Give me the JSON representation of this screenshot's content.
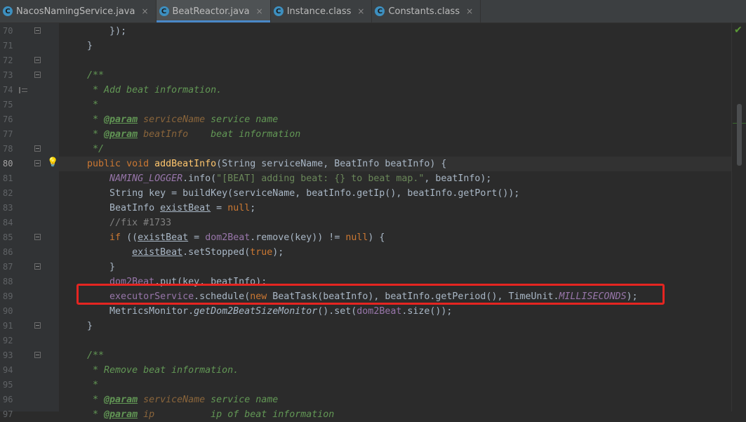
{
  "tabs": [
    {
      "label": "NacosNamingService.java",
      "icon": "C",
      "active": false
    },
    {
      "label": "BeatReactor.java",
      "icon": "C",
      "active": true
    },
    {
      "label": "Instance.class",
      "icon": "C",
      "active": false
    },
    {
      "label": "Constants.class",
      "icon": "C",
      "active": false
    }
  ],
  "tab_close_glyph": "×",
  "current_line": 80,
  "lines": [
    {
      "n": "70",
      "segs": [
        {
          "t": "        "
        },
        {
          "t": "}"
        },
        {
          "t": ");"
        }
      ]
    },
    {
      "n": "71",
      "segs": [
        {
          "t": "    }"
        }
      ]
    },
    {
      "n": "72",
      "segs": []
    },
    {
      "n": "73",
      "segs": [
        {
          "t": "    "
        },
        {
          "t": "/**",
          "c": "doc"
        }
      ]
    },
    {
      "n": "74",
      "segs": [
        {
          "t": "     * Add beat information.",
          "c": "doc"
        }
      ]
    },
    {
      "n": "75",
      "segs": [
        {
          "t": "     *",
          "c": "doc"
        }
      ]
    },
    {
      "n": "76",
      "segs": [
        {
          "t": "     * ",
          "c": "doc"
        },
        {
          "t": "@param",
          "c": "doctag"
        },
        {
          "t": " ",
          "c": "doc"
        },
        {
          "t": "serviceName",
          "c": "docparam"
        },
        {
          "t": " service name",
          "c": "doc"
        }
      ]
    },
    {
      "n": "77",
      "segs": [
        {
          "t": "     * ",
          "c": "doc"
        },
        {
          "t": "@param",
          "c": "doctag"
        },
        {
          "t": " ",
          "c": "doc"
        },
        {
          "t": "beatInfo",
          "c": "docparam"
        },
        {
          "t": "    beat information",
          "c": "doc"
        }
      ]
    },
    {
      "n": "78",
      "segs": [
        {
          "t": "     */",
          "c": "doc"
        }
      ]
    },
    {
      "n": "80",
      "segs": [
        {
          "t": "    "
        },
        {
          "t": "public void ",
          "c": "kw"
        },
        {
          "t": "addBeatInfo",
          "c": "method"
        },
        {
          "t": "(String serviceName, BeatInfo beatInfo) {"
        }
      ]
    },
    {
      "n": "81",
      "segs": [
        {
          "t": "        "
        },
        {
          "t": "NAMING_LOGGER",
          "c": "static"
        },
        {
          "t": ".info("
        },
        {
          "t": "\"[BEAT] adding beat: {} to beat map.\"",
          "c": "str"
        },
        {
          "t": ", beatInfo);"
        }
      ]
    },
    {
      "n": "82",
      "segs": [
        {
          "t": "        String key = buildKey(serviceName, beatInfo.getIp(), beatInfo.getPort());"
        }
      ]
    },
    {
      "n": "83",
      "segs": [
        {
          "t": "        BeatInfo "
        },
        {
          "t": "existBeat",
          "c": "under"
        },
        {
          "t": " = "
        },
        {
          "t": "null",
          "c": "kw"
        },
        {
          "t": ";"
        }
      ]
    },
    {
      "n": "84",
      "segs": [
        {
          "t": "        "
        },
        {
          "t": "//fix #1733",
          "c": "comment"
        }
      ]
    },
    {
      "n": "85",
      "segs": [
        {
          "t": "        "
        },
        {
          "t": "if",
          "c": "kw"
        },
        {
          "t": " (("
        },
        {
          "t": "existBeat",
          "c": "under"
        },
        {
          "t": " = "
        },
        {
          "t": "dom2Beat",
          "c": "field"
        },
        {
          "t": ".remove(key)) != "
        },
        {
          "t": "null",
          "c": "kw"
        },
        {
          "t": ") {"
        }
      ]
    },
    {
      "n": "86",
      "segs": [
        {
          "t": "            "
        },
        {
          "t": "existBeat",
          "c": "under"
        },
        {
          "t": ".setStopped("
        },
        {
          "t": "true",
          "c": "kw"
        },
        {
          "t": ");"
        }
      ]
    },
    {
      "n": "87",
      "segs": [
        {
          "t": "        }"
        }
      ]
    },
    {
      "n": "88",
      "segs": [
        {
          "t": "        "
        },
        {
          "t": "dom2Beat",
          "c": "field"
        },
        {
          "t": ".put(key, beatInfo);"
        }
      ]
    },
    {
      "n": "89",
      "segs": [
        {
          "t": "        "
        },
        {
          "t": "executorService",
          "c": "field"
        },
        {
          "t": ".schedule("
        },
        {
          "t": "new ",
          "c": "kw"
        },
        {
          "t": "BeatTask(beatInfo), beatInfo.getPeriod(), TimeUnit."
        },
        {
          "t": "MILLISECONDS",
          "c": "static"
        },
        {
          "t": ");"
        }
      ]
    },
    {
      "n": "90",
      "segs": [
        {
          "t": "        MetricsMonitor."
        },
        {
          "t": "getDom2BeatSizeMonitor",
          "c": "staticm"
        },
        {
          "t": "().set("
        },
        {
          "t": "dom2Beat",
          "c": "field"
        },
        {
          "t": ".size());"
        }
      ]
    },
    {
      "n": "91",
      "segs": [
        {
          "t": "    }"
        }
      ]
    },
    {
      "n": "92",
      "segs": []
    },
    {
      "n": "93",
      "segs": [
        {
          "t": "    "
        },
        {
          "t": "/**",
          "c": "doc"
        }
      ]
    },
    {
      "n": "94",
      "segs": [
        {
          "t": "     * Remove beat information.",
          "c": "doc"
        }
      ]
    },
    {
      "n": "95",
      "segs": [
        {
          "t": "     *",
          "c": "doc"
        }
      ]
    },
    {
      "n": "96",
      "segs": [
        {
          "t": "     * ",
          "c": "doc"
        },
        {
          "t": "@param",
          "c": "doctag"
        },
        {
          "t": " ",
          "c": "doc"
        },
        {
          "t": "serviceName",
          "c": "docparam"
        },
        {
          "t": " service name",
          "c": "doc"
        }
      ]
    },
    {
      "n": "97",
      "segs": [
        {
          "t": "     * ",
          "c": "doc"
        },
        {
          "t": "@param",
          "c": "doctag"
        },
        {
          "t": " ",
          "c": "doc"
        },
        {
          "t": "ip",
          "c": "docparam"
        },
        {
          "t": "          ip of beat information",
          "c": "doc"
        }
      ]
    }
  ],
  "gutter": {
    "fold_lines": [
      "70",
      "72",
      "73",
      "78",
      "80",
      "85",
      "87",
      "91",
      "93"
    ],
    "doc_icon_lines": [
      "74"
    ],
    "bulb_lines": [
      "80"
    ],
    "bulb_glyph": "💡"
  },
  "right_rail": {
    "check_glyph": "✔"
  },
  "colors": {
    "background": "#2b2b2b",
    "gutter": "#313335",
    "tabbar": "#3c3f41",
    "highlight_box": "#e52521",
    "keyword": "#cc7832",
    "string": "#6a8759",
    "field": "#9876aa",
    "doc": "#629755"
  }
}
